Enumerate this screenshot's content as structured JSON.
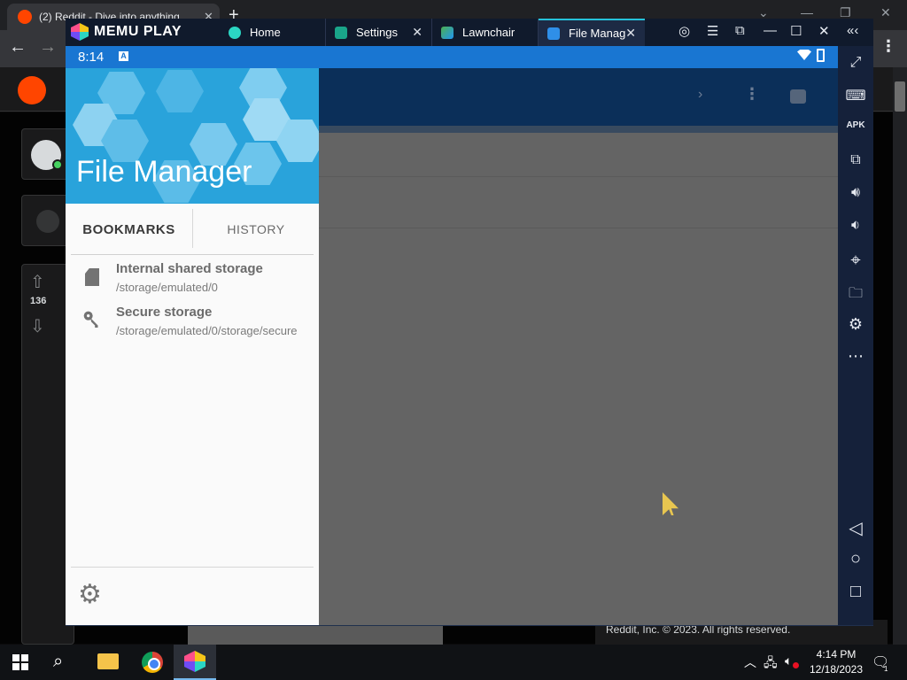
{
  "browser": {
    "tab_title": "(2) Reddit - Dive into anything",
    "new_tab_glyph": "+",
    "close_glyph": "✕",
    "back_glyph": "←",
    "forward_glyph": "→",
    "menu_glyph": "⋮",
    "win_min": "—",
    "win_max": "❐",
    "win_close": "✕",
    "footer": "Reddit, Inc. © 2023. All rights reserved.",
    "vote_count": "136"
  },
  "memu": {
    "brand": "MEMU PLAY",
    "tabs": [
      {
        "label": "Home",
        "icon": "home-app-icon"
      },
      {
        "label": "Settings",
        "icon": "settings-app-icon"
      },
      {
        "label": "Lawnchair",
        "icon": "lawnchair-app-icon"
      },
      {
        "label": "File Manag",
        "icon": "file-manager-app-icon"
      }
    ],
    "controls": {
      "account": "◎",
      "menu": "☰",
      "pip": "⧉",
      "minimize": "—",
      "maximize": "☐",
      "close": "✕",
      "collapse": "«‹"
    },
    "sidebar": [
      {
        "name": "fullscreen-icon",
        "glyph": "⤢"
      },
      {
        "name": "keyboard-icon",
        "glyph": "⌨"
      },
      {
        "name": "apk-icon",
        "glyph": "APK"
      },
      {
        "name": "multi-window-icon",
        "glyph": "⧉"
      },
      {
        "name": "volume-up-icon",
        "glyph": "🔊︎"
      },
      {
        "name": "volume-down-icon",
        "glyph": "🔉︎"
      },
      {
        "name": "location-icon",
        "glyph": "⌖"
      },
      {
        "name": "folder-icon",
        "glyph": "🗀"
      },
      {
        "name": "settings-icon",
        "glyph": "⚙"
      },
      {
        "name": "more-icon",
        "glyph": "⋯"
      }
    ],
    "nav": {
      "back": "◁",
      "home": "○",
      "recents": "□"
    }
  },
  "android": {
    "status_time": "8:14",
    "status_a": "A"
  },
  "drawer": {
    "title": "File Manager",
    "tabs": {
      "bookmarks": "BOOKMARKS",
      "history": "HISTORY"
    },
    "items": [
      {
        "name": "Internal shared storage",
        "path": "/storage/emulated/0",
        "icon": "sd-card-icon"
      },
      {
        "name": "Secure storage",
        "path": "/storage/emulated/0/storage/secure",
        "icon": "key-icon"
      }
    ],
    "settings_glyph": "⚙"
  },
  "appbar": {
    "chevron": "›",
    "overflow": "⋮"
  },
  "taskbar": {
    "search_glyph": "⌕",
    "tray_chevron": "︿",
    "time": "4:14 PM",
    "date": "12/18/2023",
    "notif_glyph": "🗨",
    "notif_count": "1"
  },
  "colors": {
    "accent": "#29a3db",
    "status_bar": "#1976d2",
    "memu_dark": "#101a2c"
  }
}
